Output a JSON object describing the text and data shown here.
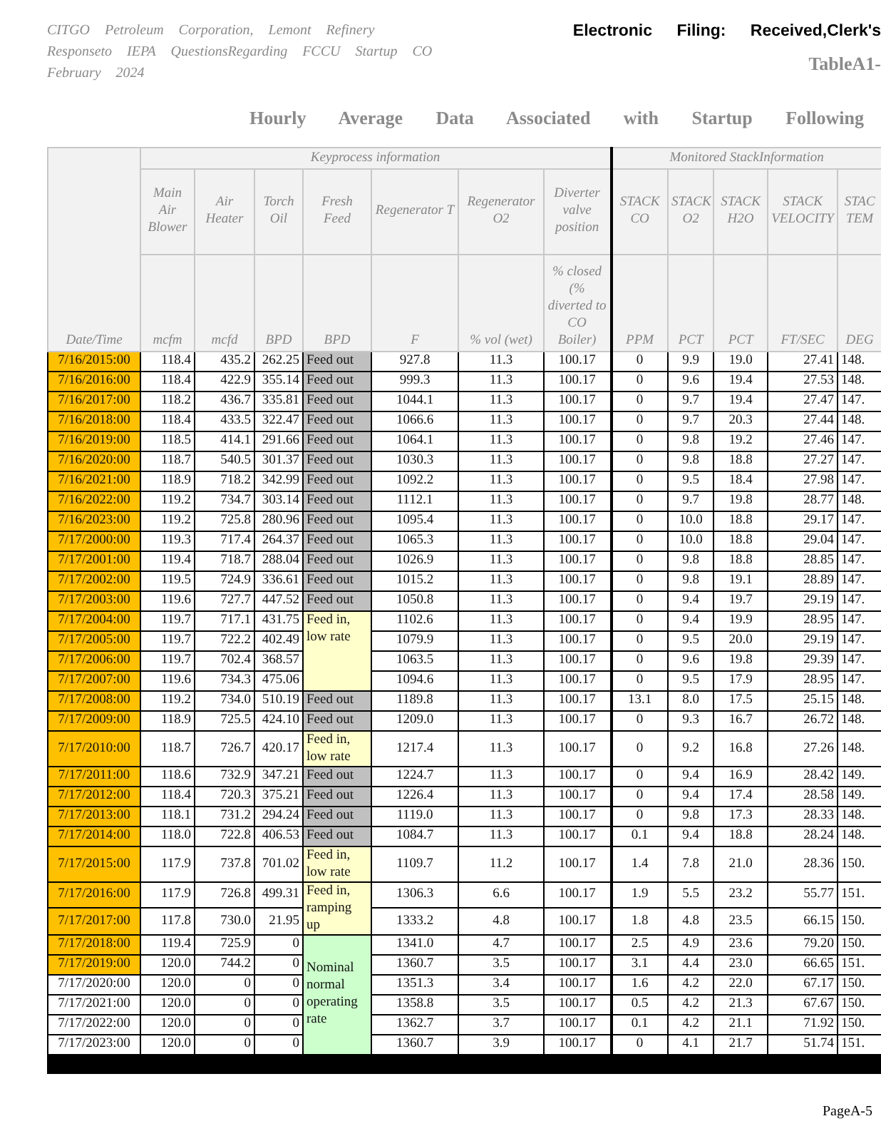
{
  "header": {
    "lines": [
      "CITGO Petroleum Corporation, Lemont Refinery",
      "Responseto IEPA QuestionsRegarding FCCU Startup CO",
      "February 2024"
    ],
    "filing": "Electronic Filing: Received,Clerk's",
    "table_label": "TableA1-",
    "title": "Hourly Average Data Associated with Startup Following"
  },
  "table": {
    "date_heading": "Date/Time",
    "groups": [
      {
        "label": "Keyprocess information",
        "columns": [
          {
            "name": "Main Air Blower",
            "unit": "mcfm"
          },
          {
            "name": "Air Heater",
            "unit": "mcfd"
          },
          {
            "name": "Torch Oil",
            "unit": "BPD"
          },
          {
            "name": "Fresh Feed",
            "unit": "BPD"
          },
          {
            "name": "Regenerator T",
            "unit": "F"
          },
          {
            "name": "Regenerator O2",
            "unit": "% vol (wet)"
          },
          {
            "name": "Diverter valve position",
            "unit": "% closed (% diverted to CO Boiler)"
          }
        ]
      },
      {
        "label": "Monitored StackInformation",
        "columns": [
          {
            "name": "STACK CO",
            "unit": "PPM"
          },
          {
            "name": "STACK O2",
            "unit": "PCT"
          },
          {
            "name": "STACK H2O",
            "unit": "PCT"
          },
          {
            "name": "STACK VELOCITY",
            "unit": "FT/SEC"
          },
          {
            "name": "STAC TEM",
            "unit": "DEG"
          }
        ]
      }
    ],
    "rows": [
      {
        "date": "7/16/2015:00",
        "date_highlighted": true,
        "fresh_feed": {
          "text": "Feed out",
          "kind": "out"
        },
        "values": [
          "118.4",
          "435.2",
          "262.25",
          "927.8",
          "11.3",
          "100.17",
          "0",
          "9.9",
          "19.0",
          "27.41",
          "148."
        ]
      },
      {
        "date": "7/16/2016:00",
        "date_highlighted": true,
        "fresh_feed": {
          "text": "Feed out",
          "kind": "out"
        },
        "values": [
          "118.4",
          "422.9",
          "355.14",
          "999.3",
          "11.3",
          "100.17",
          "0",
          "9.6",
          "19.4",
          "27.53",
          "148."
        ]
      },
      {
        "date": "7/16/2017:00",
        "date_highlighted": true,
        "fresh_feed": {
          "text": "Feed out",
          "kind": "out"
        },
        "values": [
          "118.2",
          "436.7",
          "335.81",
          "1044.1",
          "11.3",
          "100.17",
          "0",
          "9.7",
          "19.4",
          "27.47",
          "147."
        ]
      },
      {
        "date": "7/16/2018:00",
        "date_highlighted": true,
        "fresh_feed": {
          "text": "Feed out",
          "kind": "out"
        },
        "values": [
          "118.4",
          "433.5",
          "322.47",
          "1066.6",
          "11.3",
          "100.17",
          "0",
          "9.7",
          "20.3",
          "27.44",
          "148."
        ]
      },
      {
        "date": "7/16/2019:00",
        "date_highlighted": true,
        "fresh_feed": {
          "text": "Feed out",
          "kind": "out"
        },
        "values": [
          "118.5",
          "414.1",
          "291.66",
          "1064.1",
          "11.3",
          "100.17",
          "0",
          "9.8",
          "19.2",
          "27.46",
          "147."
        ]
      },
      {
        "date": "7/16/2020:00",
        "date_highlighted": true,
        "fresh_feed": {
          "text": "Feed out",
          "kind": "out"
        },
        "values": [
          "118.7",
          "540.5",
          "301.37",
          "1030.3",
          "11.3",
          "100.17",
          "0",
          "9.8",
          "18.8",
          "27.27",
          "147."
        ]
      },
      {
        "date": "7/16/2021:00",
        "date_highlighted": true,
        "fresh_feed": {
          "text": "Feed out",
          "kind": "out"
        },
        "values": [
          "118.9",
          "718.2",
          "342.99",
          "1092.2",
          "11.3",
          "100.17",
          "0",
          "9.5",
          "18.4",
          "27.98",
          "147."
        ]
      },
      {
        "date": "7/16/2022:00",
        "date_highlighted": true,
        "fresh_feed": {
          "text": "Feed out",
          "kind": "out"
        },
        "values": [
          "119.2",
          "734.7",
          "303.14",
          "1112.1",
          "11.3",
          "100.17",
          "0",
          "9.7",
          "19.8",
          "28.77",
          "148."
        ]
      },
      {
        "date": "7/16/2023:00",
        "date_highlighted": true,
        "fresh_feed": {
          "text": "Feed out",
          "kind": "out"
        },
        "values": [
          "119.2",
          "725.8",
          "280.96",
          "1095.4",
          "11.3",
          "100.17",
          "0",
          "10.0",
          "18.8",
          "29.17",
          "147."
        ]
      },
      {
        "date": "7/17/2000:00",
        "date_highlighted": true,
        "fresh_feed": {
          "text": "Feed out",
          "kind": "out"
        },
        "values": [
          "119.3",
          "717.4",
          "264.37",
          "1065.3",
          "11.3",
          "100.17",
          "0",
          "10.0",
          "18.8",
          "29.04",
          "147."
        ]
      },
      {
        "date": "7/17/2001:00",
        "date_highlighted": true,
        "fresh_feed": {
          "text": "Feed out",
          "kind": "out"
        },
        "values": [
          "119.4",
          "718.7",
          "288.04",
          "1026.9",
          "11.3",
          "100.17",
          "0",
          "9.8",
          "18.8",
          "28.85",
          "147."
        ]
      },
      {
        "date": "7/17/2002:00",
        "date_highlighted": true,
        "fresh_feed": {
          "text": "Feed out",
          "kind": "out"
        },
        "values": [
          "119.5",
          "724.9",
          "336.61",
          "1015.2",
          "11.3",
          "100.17",
          "0",
          "9.8",
          "19.1",
          "28.89",
          "147."
        ]
      },
      {
        "date": "7/17/2003:00",
        "date_highlighted": true,
        "fresh_feed": {
          "text": "Feed out",
          "kind": "out"
        },
        "values": [
          "119.6",
          "727.7",
          "447.52",
          "1050.8",
          "11.3",
          "100.17",
          "0",
          "9.4",
          "19.7",
          "29.19",
          "147."
        ]
      },
      {
        "date": "7/17/2004:00",
        "date_highlighted": true,
        "fresh_feed": {
          "text": "Feed in, low rate",
          "kind": "in"
        },
        "values": [
          "119.7",
          "717.1",
          "431.75",
          "1102.6",
          "11.3",
          "100.17",
          "0",
          "9.4",
          "19.9",
          "28.95",
          "147."
        ]
      },
      {
        "date": "7/17/2005:00",
        "date_highlighted": true,
        "values": [
          "119.7",
          "722.2",
          "402.49",
          "1079.9",
          "11.3",
          "100.17",
          "0",
          "9.5",
          "20.0",
          "29.19",
          "147."
        ]
      },
      {
        "date": "7/17/2006:00",
        "date_highlighted": true,
        "values": [
          "119.7",
          "702.4",
          "368.57",
          "1063.5",
          "11.3",
          "100.17",
          "0",
          "9.6",
          "19.8",
          "29.39",
          "147."
        ]
      },
      {
        "date": "7/17/2007:00",
        "date_highlighted": true,
        "values": [
          "119.6",
          "734.3",
          "475.06",
          "1094.6",
          "11.3",
          "100.17",
          "0",
          "9.5",
          "17.9",
          "28.95",
          "147."
        ]
      },
      {
        "date": "7/17/2008:00",
        "date_highlighted": true,
        "fresh_feed": {
          "text": "Feed out",
          "kind": "out"
        },
        "values": [
          "119.2",
          "734.0",
          "510.19",
          "1189.8",
          "11.3",
          "100.17",
          "13.1",
          "8.0",
          "17.5",
          "25.15",
          "148."
        ]
      },
      {
        "date": "7/17/2009:00",
        "date_highlighted": true,
        "fresh_feed": {
          "text": "Feed out",
          "kind": "out"
        },
        "values": [
          "118.9",
          "725.5",
          "424.10",
          "1209.0",
          "11.3",
          "100.17",
          "0",
          "9.3",
          "16.7",
          "26.72",
          "148."
        ]
      },
      {
        "date": "7/17/2010:00",
        "date_highlighted": true,
        "fresh_feed": {
          "text": "Feed in, low rate",
          "kind": "in"
        },
        "values": [
          "118.7",
          "726.7",
          "420.17",
          "1217.4",
          "11.3",
          "100.17",
          "0",
          "9.2",
          "16.8",
          "27.26",
          "148."
        ]
      },
      {
        "date": "7/17/2011:00",
        "date_highlighted": true,
        "fresh_feed": {
          "text": "Feed out",
          "kind": "out"
        },
        "values": [
          "118.6",
          "732.9",
          "347.21",
          "1224.7",
          "11.3",
          "100.17",
          "0",
          "9.4",
          "16.9",
          "28.42",
          "149."
        ]
      },
      {
        "date": "7/17/2012:00",
        "date_highlighted": true,
        "fresh_feed": {
          "text": "Feed out",
          "kind": "out"
        },
        "values": [
          "118.4",
          "720.3",
          "375.21",
          "1226.4",
          "11.3",
          "100.17",
          "0",
          "9.4",
          "17.4",
          "28.58",
          "149."
        ]
      },
      {
        "date": "7/17/2013:00",
        "date_highlighted": true,
        "fresh_feed": {
          "text": "Feed out",
          "kind": "out"
        },
        "values": [
          "118.1",
          "731.2",
          "294.24",
          "1119.0",
          "11.3",
          "100.17",
          "0",
          "9.8",
          "17.3",
          "28.33",
          "148."
        ]
      },
      {
        "date": "7/17/2014:00",
        "date_highlighted": true,
        "fresh_feed": {
          "text": "Feed out",
          "kind": "out"
        },
        "values": [
          "118.0",
          "722.8",
          "406.53",
          "1084.7",
          "11.3",
          "100.17",
          "0.1",
          "9.4",
          "18.8",
          "28.24",
          "148."
        ]
      },
      {
        "date": "7/17/2015:00",
        "date_highlighted": true,
        "fresh_feed": {
          "text": "Feed in, low rate",
          "kind": "in"
        },
        "values": [
          "117.9",
          "737.8",
          "701.02",
          "1109.7",
          "11.2",
          "100.17",
          "1.4",
          "7.8",
          "21.0",
          "28.36",
          "150."
        ]
      },
      {
        "date": "7/17/2016:00",
        "date_highlighted": true,
        "fresh_feed": {
          "text": "Feed in, ramping up",
          "kind": "in"
        },
        "values": [
          "117.9",
          "726.8",
          "499.31",
          "1306.3",
          "6.6",
          "100.17",
          "1.9",
          "5.5",
          "23.2",
          "55.77",
          "151."
        ]
      },
      {
        "date": "7/17/2017:00",
        "date_highlighted": true,
        "values": [
          "117.8",
          "730.0",
          "21.95",
          "1333.2",
          "4.8",
          "100.17",
          "1.8",
          "4.8",
          "23.5",
          "66.15",
          "150."
        ]
      },
      {
        "date": "7/17/2018:00",
        "date_highlighted": true,
        "fresh_feed": {
          "text": "Nominal normal operating rate",
          "kind": "nominal"
        },
        "values": [
          "119.4",
          "725.9",
          "0",
          "1341.0",
          "4.7",
          "100.17",
          "2.5",
          "4.9",
          "23.6",
          "79.20",
          "150."
        ]
      },
      {
        "date": "7/17/2019:00",
        "date_highlighted": true,
        "values": [
          "120.0",
          "744.2",
          "0",
          "1360.7",
          "3.5",
          "100.17",
          "3.1",
          "4.4",
          "23.0",
          "66.65",
          "151."
        ]
      },
      {
        "date": "7/17/2020:00",
        "date_highlighted": false,
        "values": [
          "120.0",
          "0",
          "0",
          "1351.3",
          "3.4",
          "100.17",
          "1.6",
          "4.2",
          "22.0",
          "67.17",
          "150."
        ]
      },
      {
        "date": "7/17/2021:00",
        "date_highlighted": false,
        "values": [
          "120.0",
          "0",
          "0",
          "1358.8",
          "3.5",
          "100.17",
          "0.5",
          "4.2",
          "21.3",
          "67.67",
          "150."
        ]
      },
      {
        "date": "7/17/2022:00",
        "date_highlighted": false,
        "values": [
          "120.0",
          "0",
          "0",
          "1362.7",
          "3.7",
          "100.17",
          "0.1",
          "4.2",
          "21.1",
          "71.92",
          "150."
        ]
      },
      {
        "date": "7/17/2023:00",
        "date_highlighted": false,
        "values": [
          "120.0",
          "0",
          "0",
          "1360.7",
          "3.9",
          "100.17",
          "0",
          "4.1",
          "21.7",
          "51.74",
          "151."
        ]
      }
    ]
  },
  "page_number": "PageA-5"
}
